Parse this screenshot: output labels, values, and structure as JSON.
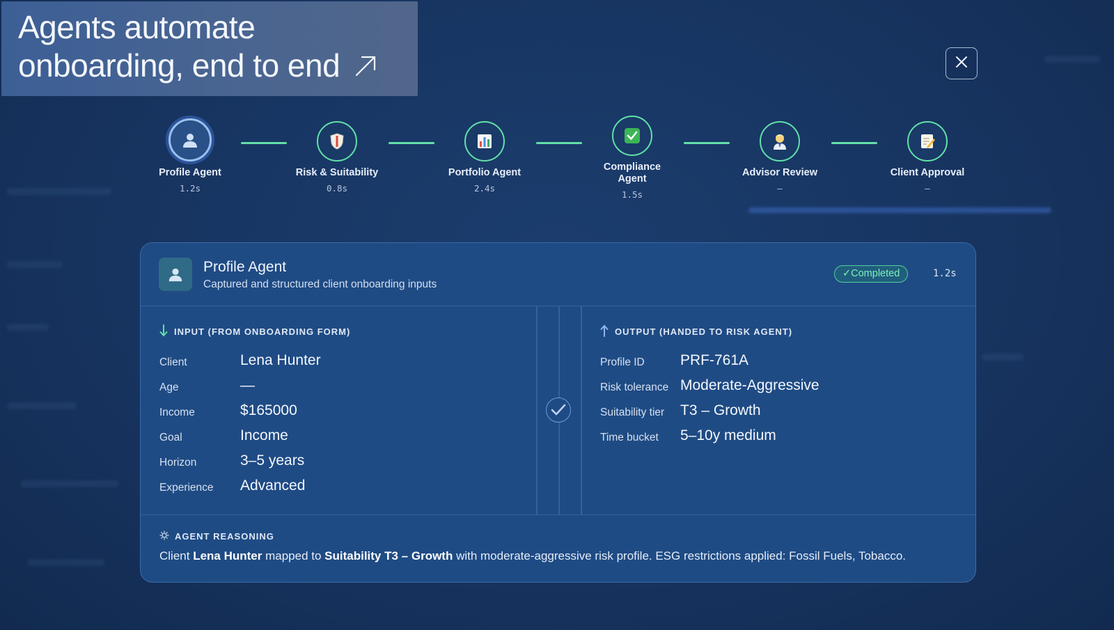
{
  "hero": {
    "title_line1": "Agents automate",
    "title_line2": "onboarding, end to end"
  },
  "close": {
    "icon": "close-icon"
  },
  "steps": [
    {
      "label": "Profile Agent",
      "time": "1.2s",
      "icon": "person-icon",
      "status": "active"
    },
    {
      "label": "Risk & Suitability",
      "time": "0.8s",
      "icon": "shield-icon",
      "status": "done"
    },
    {
      "label": "Portfolio Agent",
      "time": "2.4s",
      "icon": "bar-chart-icon",
      "status": "done"
    },
    {
      "label": "Compliance Agent",
      "label_line1": "Compliance",
      "label_line2": "Agent",
      "time": "1.5s",
      "icon": "check-box-icon",
      "status": "done"
    },
    {
      "label": "Advisor Review",
      "time": "–",
      "icon": "advisor-icon",
      "status": "done"
    },
    {
      "label": "Client Approval",
      "time": "–",
      "icon": "memo-icon",
      "status": "done"
    }
  ],
  "card": {
    "title": "Profile Agent",
    "subtitle": "Captured and structured client onboarding inputs",
    "status": "✓Completed",
    "time": "1.2s",
    "input": {
      "heading": "INPUT (FROM ONBOARDING FORM)",
      "rows": [
        {
          "key": "Client",
          "value": "Lena Hunter"
        },
        {
          "key": "Age",
          "value": "—"
        },
        {
          "key": "Income",
          "value": "$165000"
        },
        {
          "key": "Goal",
          "value": "Income"
        },
        {
          "key": "Horizon",
          "value": "3–5 years"
        },
        {
          "key": "Experience",
          "value": "Advanced"
        }
      ]
    },
    "output": {
      "heading": "OUTPUT (HANDED TO RISK AGENT)",
      "rows": [
        {
          "key": "Profile ID",
          "value": "PRF-761A"
        },
        {
          "key": "Risk tolerance",
          "value": "Moderate-Aggressive"
        },
        {
          "key": "Suitability tier",
          "value": "T3 – Growth"
        },
        {
          "key": "Time bucket",
          "value": "5–10y medium"
        }
      ]
    },
    "reasoning": {
      "heading": "AGENT REASONING",
      "t1": "Client ",
      "b1": "Lena Hunter",
      "t2": " mapped to ",
      "b2": "Suitability T3 – Growth",
      "t3": " with moderate-aggressive risk profile. ESG restrictions applied: Fossil Fuels, Tobacco."
    }
  },
  "colors": {
    "accent_green": "#62e0a8",
    "card_bg": "#1f4b84",
    "page_bg": "#173460"
  }
}
